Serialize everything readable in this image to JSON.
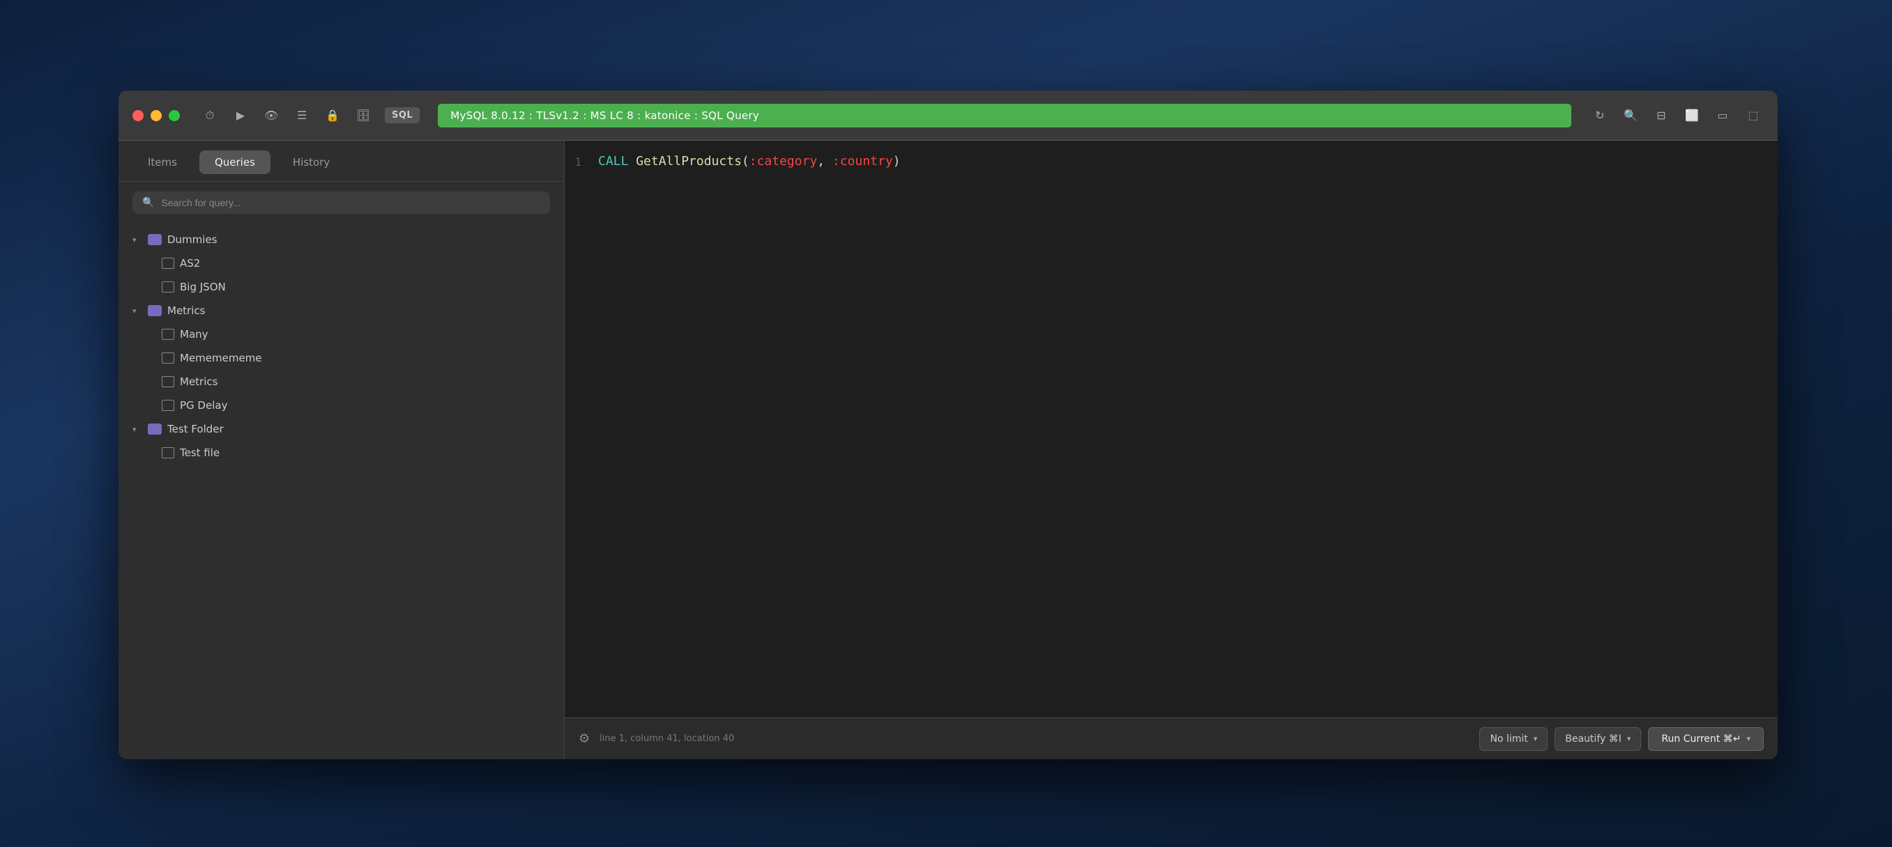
{
  "desktop": {
    "bg": "#1a2a4a"
  },
  "titlebar": {
    "sql_badge": "SQL",
    "connection_label": "MySQL 8.0.12 : TLSv1.2 : MS LC 8 : katonice : SQL Query",
    "traffic_lights": {
      "close": "close",
      "minimize": "minimize",
      "maximize": "maximize"
    }
  },
  "sidebar": {
    "tabs": [
      {
        "label": "Items",
        "active": false
      },
      {
        "label": "Queries",
        "active": true
      },
      {
        "label": "History",
        "active": false
      }
    ],
    "search_placeholder": "Search for query...",
    "tree": [
      {
        "type": "folder",
        "label": "Dummies",
        "depth": 0,
        "expanded": true
      },
      {
        "type": "file",
        "label": "AS2",
        "depth": 1
      },
      {
        "type": "file",
        "label": "Big JSON",
        "depth": 1
      },
      {
        "type": "folder",
        "label": "Metrics",
        "depth": 0,
        "expanded": true
      },
      {
        "type": "file",
        "label": "Many",
        "depth": 1
      },
      {
        "type": "file",
        "label": "Mememememe",
        "depth": 1
      },
      {
        "type": "file",
        "label": "Metrics",
        "depth": 1
      },
      {
        "type": "file",
        "label": "PG Delay",
        "depth": 1
      },
      {
        "type": "folder",
        "label": "Test Folder",
        "depth": 0,
        "expanded": true
      },
      {
        "type": "file",
        "label": "Test file",
        "depth": 1
      }
    ]
  },
  "editor": {
    "lines": [
      {
        "number": "1",
        "tokens": [
          {
            "type": "kw-call",
            "text": "CALL "
          },
          {
            "type": "kw-func",
            "text": "GetAllProducts"
          },
          {
            "type": "kw-paren",
            "text": "("
          },
          {
            "type": "kw-param",
            "text": ":category"
          },
          {
            "type": "kw-paren",
            "text": ", "
          },
          {
            "type": "kw-param",
            "text": ":country"
          },
          {
            "type": "kw-paren",
            "text": ")"
          }
        ]
      }
    ],
    "status_text": "line 1, column 41, location 40",
    "no_limit_label": "No limit",
    "beautify_label": "Beautify ⌘I",
    "run_current_label": "Run Current ⌘↵"
  }
}
